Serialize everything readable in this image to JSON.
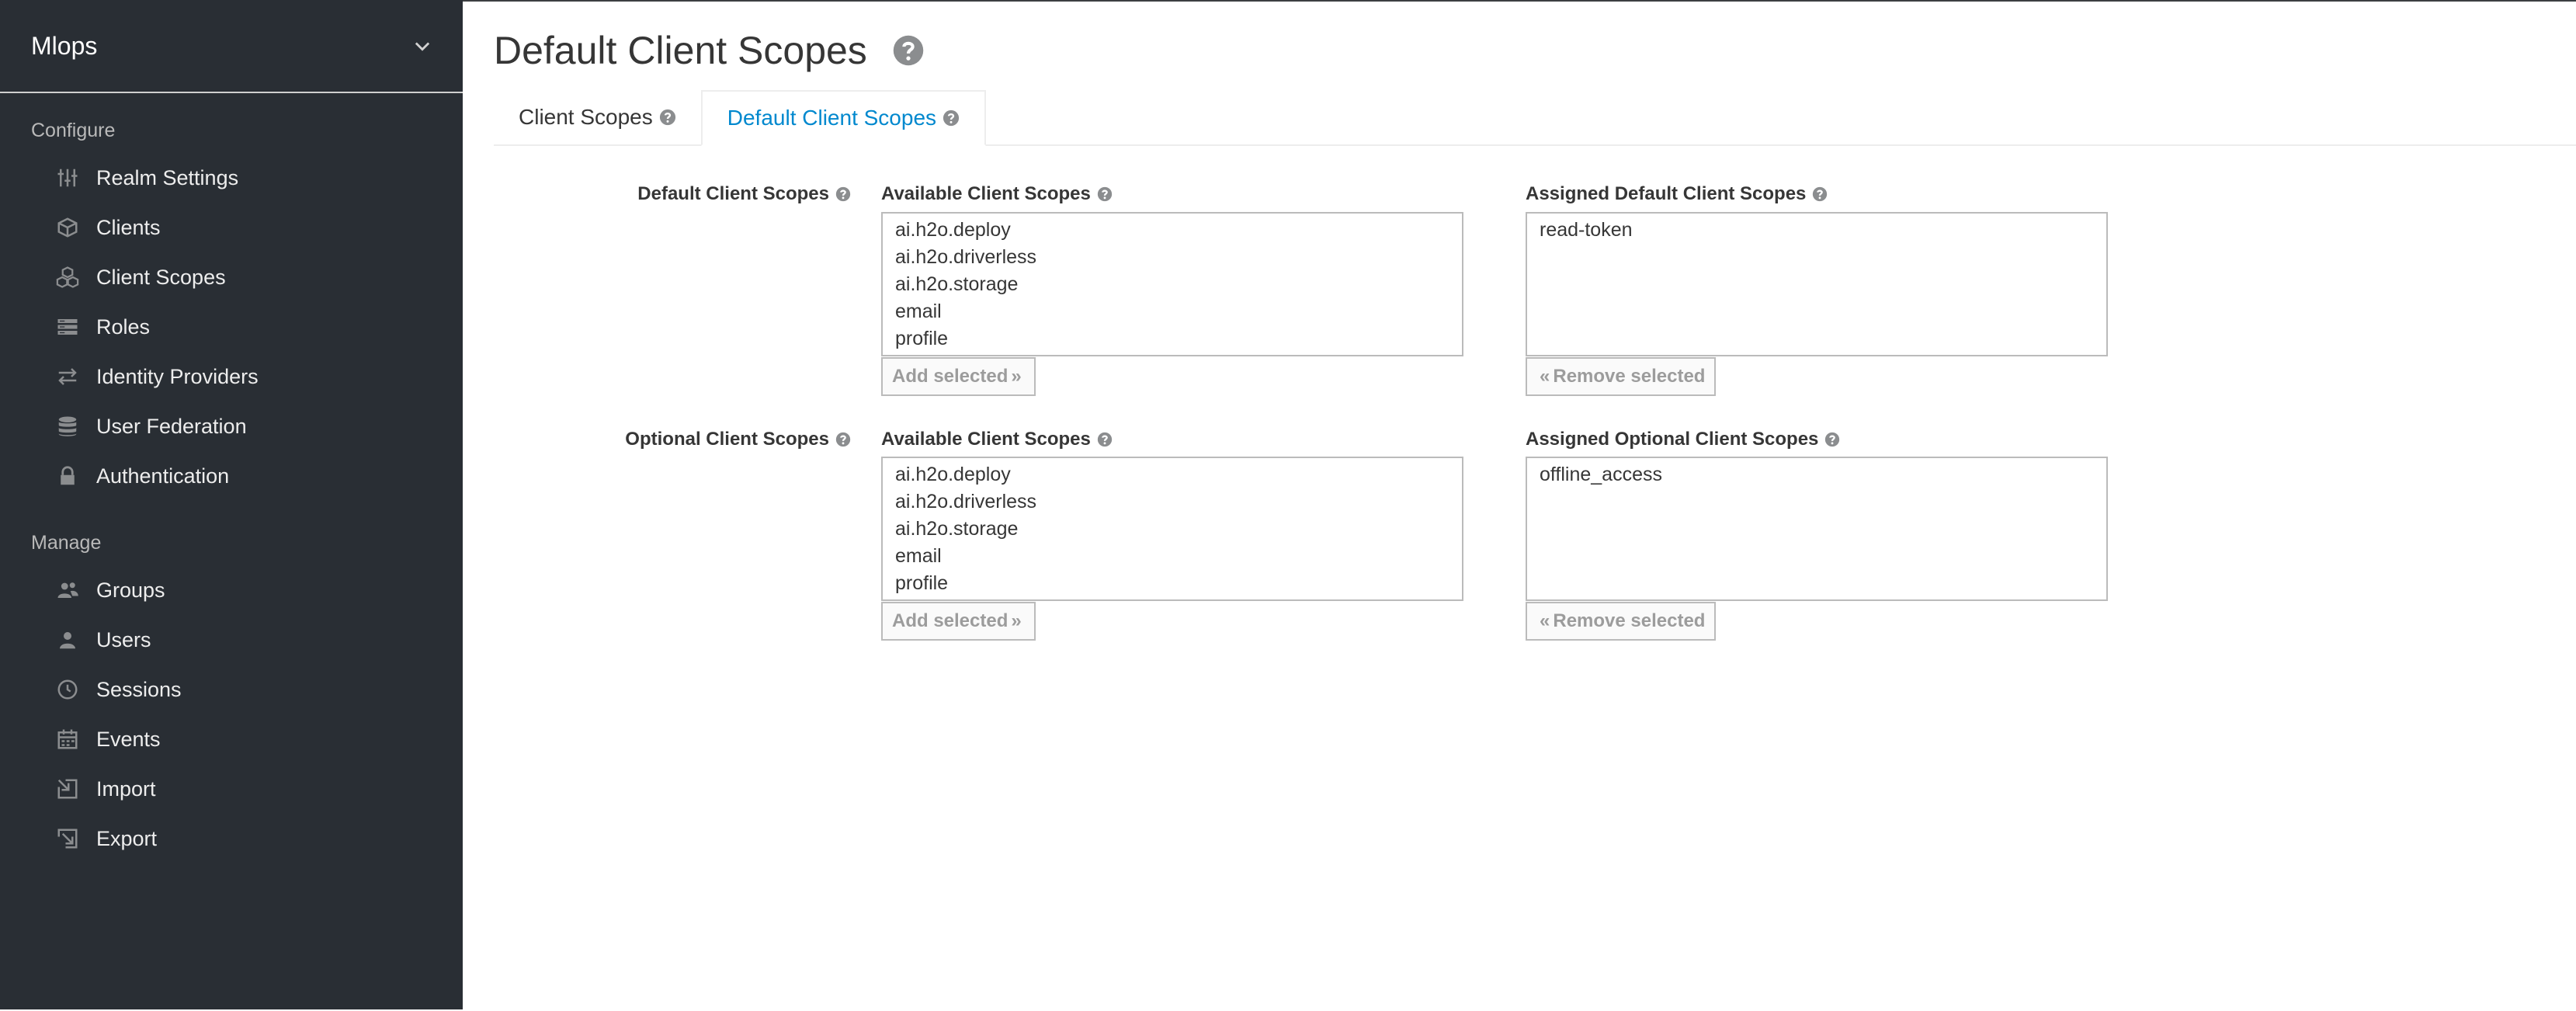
{
  "sidebar": {
    "realm": "Mlops",
    "configure_title": "Configure",
    "configure_items": [
      {
        "label": "Realm Settings",
        "icon": "sliders-icon"
      },
      {
        "label": "Clients",
        "icon": "cube-icon"
      },
      {
        "label": "Client Scopes",
        "icon": "cubes-icon"
      },
      {
        "label": "Roles",
        "icon": "roles-icon"
      },
      {
        "label": "Identity Providers",
        "icon": "exchange-icon"
      },
      {
        "label": "User Federation",
        "icon": "database-icon"
      },
      {
        "label": "Authentication",
        "icon": "lock-icon"
      }
    ],
    "manage_title": "Manage",
    "manage_items": [
      {
        "label": "Groups",
        "icon": "users-icon"
      },
      {
        "label": "Users",
        "icon": "user-icon"
      },
      {
        "label": "Sessions",
        "icon": "clock-icon"
      },
      {
        "label": "Events",
        "icon": "calendar-icon"
      },
      {
        "label": "Import",
        "icon": "import-icon"
      },
      {
        "label": "Export",
        "icon": "export-icon"
      }
    ]
  },
  "header": {
    "title": "Default Client Scopes"
  },
  "tabs": [
    {
      "label": "Client Scopes",
      "active": false
    },
    {
      "label": "Default Client Scopes",
      "active": true
    }
  ],
  "default_section": {
    "row_label": "Default Client Scopes",
    "available_label": "Available Client Scopes",
    "available": [
      "ai.h2o.deploy",
      "ai.h2o.driverless",
      "ai.h2o.storage",
      "email",
      "profile"
    ],
    "add_button": "Add selected",
    "assigned_label": "Assigned Default Client Scopes",
    "assigned": [
      "read-token"
    ],
    "remove_button": "Remove selected"
  },
  "optional_section": {
    "row_label": "Optional Client Scopes",
    "available_label": "Available Client Scopes",
    "available": [
      "ai.h2o.deploy",
      "ai.h2o.driverless",
      "ai.h2o.storage",
      "email",
      "profile"
    ],
    "add_button": "Add selected",
    "assigned_label": "Assigned Optional Client Scopes",
    "assigned": [
      "offline_access"
    ],
    "remove_button": "Remove selected"
  },
  "colors": {
    "sidebar_bg": "#292e34",
    "accent": "#0088ce"
  }
}
